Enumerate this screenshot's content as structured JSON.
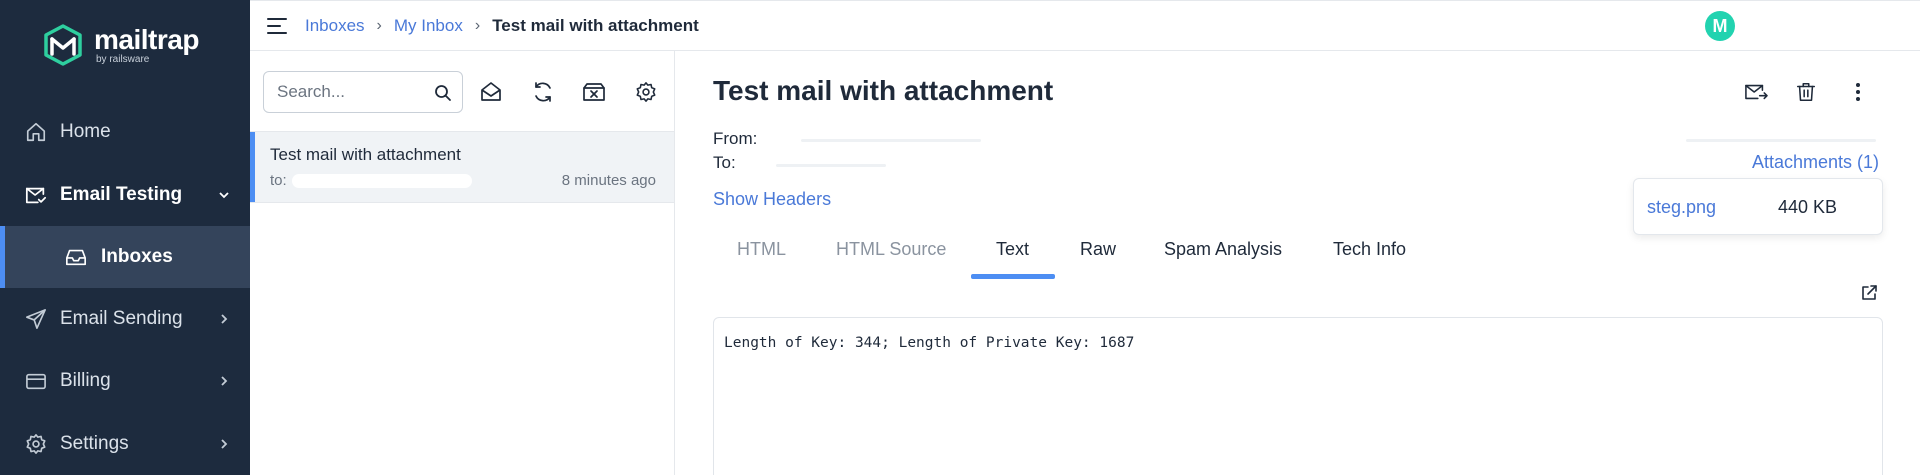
{
  "sidebar": {
    "logo": {
      "name": "mailtrap",
      "byline": "by railsware"
    },
    "items": [
      {
        "label": "Home",
        "icon": "home-icon"
      },
      {
        "label": "Email Testing",
        "icon": "envelope-check-icon"
      },
      {
        "label": "Inboxes",
        "icon": "inbox-icon"
      },
      {
        "label": "Email Sending",
        "icon": "paper-plane-icon"
      },
      {
        "label": "Billing",
        "icon": "credit-card-icon"
      },
      {
        "label": "Settings",
        "icon": "gear-icon"
      }
    ]
  },
  "header": {
    "breadcrumb": [
      "Inboxes",
      "My Inbox",
      "Test mail with attachment"
    ],
    "avatar_initial": "M",
    "avatar_color": "#22d3b0"
  },
  "list": {
    "search_placeholder": "Search...",
    "messages": [
      {
        "subject": "Test mail with attachment",
        "to_label": "to:",
        "time": "8 minutes ago"
      }
    ]
  },
  "message": {
    "title": "Test mail with attachment",
    "from_label": "From:",
    "to_label": "To:",
    "show_headers": "Show Headers",
    "attachments_link": "Attachments (1)",
    "attachments": [
      {
        "name": "steg.png",
        "size": "440 KB"
      }
    ],
    "tabs": [
      "HTML",
      "HTML Source",
      "Text",
      "Raw",
      "Spam Analysis",
      "Tech Info"
    ],
    "selected_tab": "Text",
    "body": "Length of Key: 344; Length of Private Key: 1687"
  },
  "colors": {
    "sidebar_bg": "#1d2b3e",
    "accent": "#4d8ef3",
    "link": "#4a79d8"
  }
}
